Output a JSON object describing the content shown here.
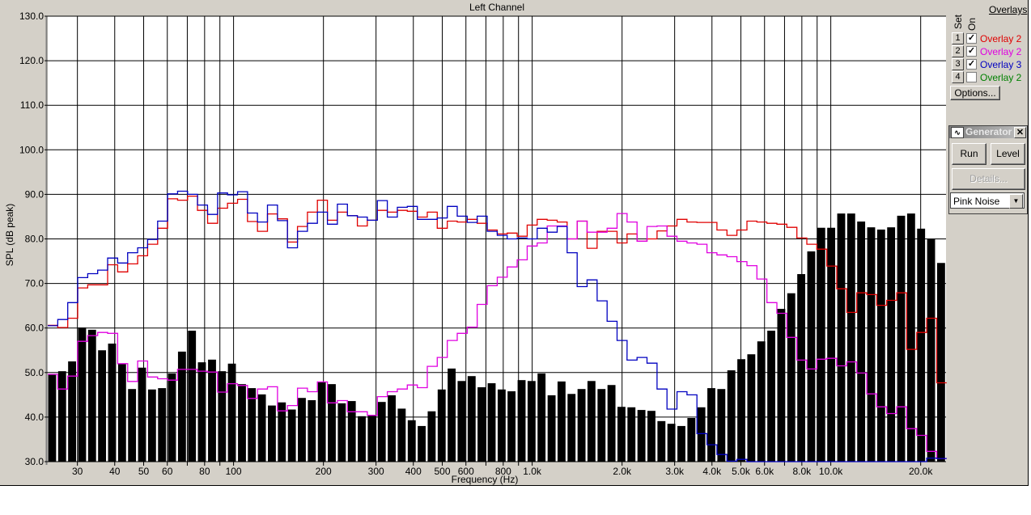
{
  "chart_data": {
    "type": "bar",
    "title": "Left Channel",
    "xlabel": "Frequency (Hz)",
    "ylabel": "SPL (dB peak)",
    "xscale": "log",
    "xlim": [
      24.1,
      24200
    ],
    "ylim": [
      30,
      130
    ],
    "grid": true,
    "y_ticks": [
      "30.0",
      "40.0",
      "50.0",
      "60.0",
      "70.0",
      "80.0",
      "90.0",
      "100.0",
      "110.0",
      "120.0",
      "130.0"
    ],
    "x_gridlines": [
      30,
      40,
      50,
      60,
      70,
      80,
      90,
      100,
      200,
      300,
      400,
      500,
      600,
      700,
      800,
      900,
      1000,
      2000,
      3000,
      4000,
      5000,
      6000,
      7000,
      8000,
      9000,
      10000,
      20000
    ],
    "x_tick_labels": [
      {
        "f": 30,
        "label": "30"
      },
      {
        "f": 40,
        "label": "40"
      },
      {
        "f": 50,
        "label": "50"
      },
      {
        "f": 60,
        "label": "60"
      },
      {
        "f": 80,
        "label": "80"
      },
      {
        "f": 100,
        "label": "100"
      },
      {
        "f": 200,
        "label": "200"
      },
      {
        "f": 300,
        "label": "300"
      },
      {
        "f": 400,
        "label": "400"
      },
      {
        "f": 500,
        "label": "500"
      },
      {
        "f": 600,
        "label": "600"
      },
      {
        "f": 800,
        "label": "800"
      },
      {
        "f": 1000,
        "label": "1.0k"
      },
      {
        "f": 2000,
        "label": "2.0k"
      },
      {
        "f": 3000,
        "label": "3.0k"
      },
      {
        "f": 4000,
        "label": "4.0k"
      },
      {
        "f": 5000,
        "label": "5.0k"
      },
      {
        "f": 6000,
        "label": "6.0k"
      },
      {
        "f": 8000,
        "label": "8.0k"
      },
      {
        "f": 10000,
        "label": "10.0k"
      },
      {
        "f": 20000,
        "label": "20.0k"
      }
    ],
    "frequencies": [
      24.8,
      26.79,
      28.93,
      31.25,
      33.75,
      36.45,
      39.37,
      42.53,
      45.93,
      49.61,
      53.58,
      57.87,
      62.5,
      67.5,
      72.9,
      78.7,
      85.1,
      91.9,
      99.2,
      107.2,
      115.7,
      125,
      135,
      145.8,
      157.5,
      170.1,
      183.7,
      198.4,
      214.3,
      231.5,
      250,
      270,
      291.6,
      315,
      340.2,
      367.4,
      396.9,
      428.6,
      462.9,
      500,
      540,
      583,
      630,
      680,
      735,
      794,
      857,
      926,
      1000,
      1080,
      1167,
      1260,
      1361,
      1470,
      1587,
      1715,
      1852,
      2000,
      2160,
      2333,
      2520,
      2722,
      2939,
      3175,
      3429,
      3703,
      4000,
      4320,
      4666,
      5040,
      5443,
      5879,
      6350,
      6858,
      7407,
      8000,
      8641,
      9332,
      10079,
      10887,
      11758,
      12699,
      13716,
      14813,
      16000,
      17281,
      18664,
      20159,
      21773,
      23516
    ],
    "bars": {
      "color": "#000000",
      "values": [
        49.5,
        50.3,
        52.5,
        60.1,
        59.6,
        55.0,
        56.5,
        51.9,
        46.3,
        51.1,
        46.2,
        46.5,
        49.8,
        54.7,
        59.4,
        52.3,
        52.9,
        50.3,
        52.0,
        47.4,
        46.5,
        45.1,
        42.6,
        43.3,
        41.7,
        44.3,
        43.8,
        47.8,
        47.4,
        43.1,
        43.6,
        40.2,
        40.4,
        43.4,
        44.9,
        41.9,
        39.3,
        38.0,
        41.3,
        46.2,
        50.9,
        48.1,
        49.2,
        46.7,
        47.6,
        46.2,
        45.8,
        48.3,
        48.1,
        49.8,
        44.9,
        48.0,
        45.2,
        46.3,
        48.1,
        46.3,
        47.2,
        42.3,
        42.2,
        41.6,
        41.4,
        39.1,
        38.5,
        38.0,
        39.8,
        42.2,
        46.5,
        46.3,
        50.5,
        53.0,
        54.1,
        57.0,
        59.4,
        64.3,
        67.8,
        72.1,
        77.2,
        82.5,
        82.5,
        85.7,
        85.7,
        83.9,
        82.6,
        82.1,
        82.6,
        85.2,
        85.7,
        82.3,
        80.0,
        74.6
      ]
    },
    "series": [
      {
        "name": "Overlay 2",
        "color": "#e00000",
        "set": 1,
        "visible": true,
        "values": [
          60.6,
          60.1,
          62.2,
          69.0,
          69.7,
          69.7,
          74.2,
          72.6,
          74.4,
          76.2,
          78.8,
          82.4,
          89.0,
          88.7,
          89.6,
          86.4,
          83.5,
          86.9,
          88.0,
          88.9,
          83.9,
          81.7,
          85.6,
          84.5,
          79.3,
          82.8,
          86.0,
          88.7,
          84.2,
          86.0,
          85.2,
          82.9,
          84.2,
          86.4,
          86.0,
          86.4,
          86.2,
          84.9,
          86.0,
          82.4,
          84.0,
          83.8,
          84.4,
          83.5,
          82.0,
          81.1,
          81.3,
          80.6,
          83.1,
          84.4,
          84.2,
          83.8,
          80.0,
          84.0,
          77.9,
          81.7,
          81.7,
          79.1,
          81.1,
          79.5,
          80.0,
          81.8,
          82.9,
          84.4,
          83.8,
          83.7,
          83.7,
          82.0,
          80.8,
          82.0,
          84.0,
          83.8,
          83.5,
          83.3,
          82.6,
          80.2,
          78.8,
          77.7,
          73.9,
          68.8,
          63.5,
          67.9,
          67.5,
          65.1,
          66.2,
          67.9,
          55.2,
          59.0,
          62.2,
          47.7
        ]
      },
      {
        "name": "Overlay 2",
        "color": "#e000e0",
        "set": 2,
        "visible": true,
        "values": [
          49.6,
          46.3,
          49.2,
          57.0,
          58.3,
          59.0,
          58.8,
          52.0,
          48.0,
          52.6,
          49.0,
          48.6,
          48.3,
          50.7,
          50.7,
          50.3,
          50.1,
          45.6,
          47.5,
          47.1,
          44.2,
          46.3,
          46.8,
          41.4,
          42.6,
          46.5,
          45.7,
          47.9,
          43.2,
          43.7,
          41.2,
          41.2,
          40.4,
          44.6,
          45.7,
          46.3,
          47.2,
          46.6,
          51.4,
          53.4,
          57.2,
          58.8,
          60.2,
          65.3,
          69.5,
          71.4,
          73.7,
          75.3,
          78.4,
          79.1,
          82.9,
          82.9,
          80.0,
          84.0,
          81.5,
          81.5,
          82.4,
          85.7,
          83.8,
          79.5,
          82.8,
          82.9,
          80.6,
          79.5,
          79.1,
          78.8,
          76.9,
          76.4,
          76.0,
          74.9,
          74.0,
          71.0,
          65.7,
          63.3,
          57.9,
          52.8,
          50.8,
          53.0,
          53.2,
          51.5,
          52.4,
          49.9,
          45.2,
          42.3,
          40.8,
          42.3,
          37.4,
          35.9,
          32.3,
          30.7
        ]
      },
      {
        "name": "Overlay 3",
        "color": "#0000c0",
        "set": 3,
        "visible": true,
        "values": [
          60.5,
          61.9,
          65.7,
          71.3,
          72.2,
          73.0,
          75.7,
          74.6,
          76.9,
          78.0,
          79.9,
          84.0,
          90.1,
          90.7,
          90.0,
          87.6,
          85.5,
          90.3,
          89.9,
          90.6,
          85.8,
          83.8,
          87.6,
          84.1,
          78.0,
          81.7,
          83.5,
          86.0,
          83.3,
          87.8,
          85.2,
          84.9,
          84.2,
          88.6,
          84.9,
          87.1,
          87.3,
          84.4,
          84.4,
          84.7,
          87.3,
          85.1,
          83.7,
          85.1,
          81.7,
          80.8,
          80.0,
          80.2,
          80.0,
          82.4,
          81.5,
          82.8,
          76.9,
          69.3,
          70.8,
          66.1,
          61.5,
          57.2,
          52.8,
          53.4,
          52.1,
          46.3,
          41.8,
          45.7,
          45.0,
          36.3,
          33.8,
          31.6,
          30.1,
          30.5,
          30,
          30,
          30,
          30,
          30,
          30,
          30,
          30,
          30,
          30,
          30,
          30,
          30,
          30,
          30,
          30,
          30,
          30,
          30.8,
          30.7
        ]
      }
    ]
  },
  "overlays": {
    "title": "Overlays",
    "set_label": "Set",
    "on_label": "On",
    "rows": [
      {
        "set": "1",
        "checked": true,
        "label": "Overlay 2",
        "color": "#e00000"
      },
      {
        "set": "2",
        "checked": true,
        "label": "Overlay 2",
        "color": "#e000e0"
      },
      {
        "set": "3",
        "checked": true,
        "label": "Overlay 3",
        "color": "#0000c0"
      },
      {
        "set": "4",
        "checked": false,
        "label": "Overlay 2",
        "color": "#008000"
      }
    ],
    "options_label": "Options..."
  },
  "generator": {
    "title": "Generator",
    "icon": "waveform-icon",
    "run_label": "Run",
    "level_label": "Level",
    "details_label": "Details...",
    "signal": "Pink Noise"
  }
}
